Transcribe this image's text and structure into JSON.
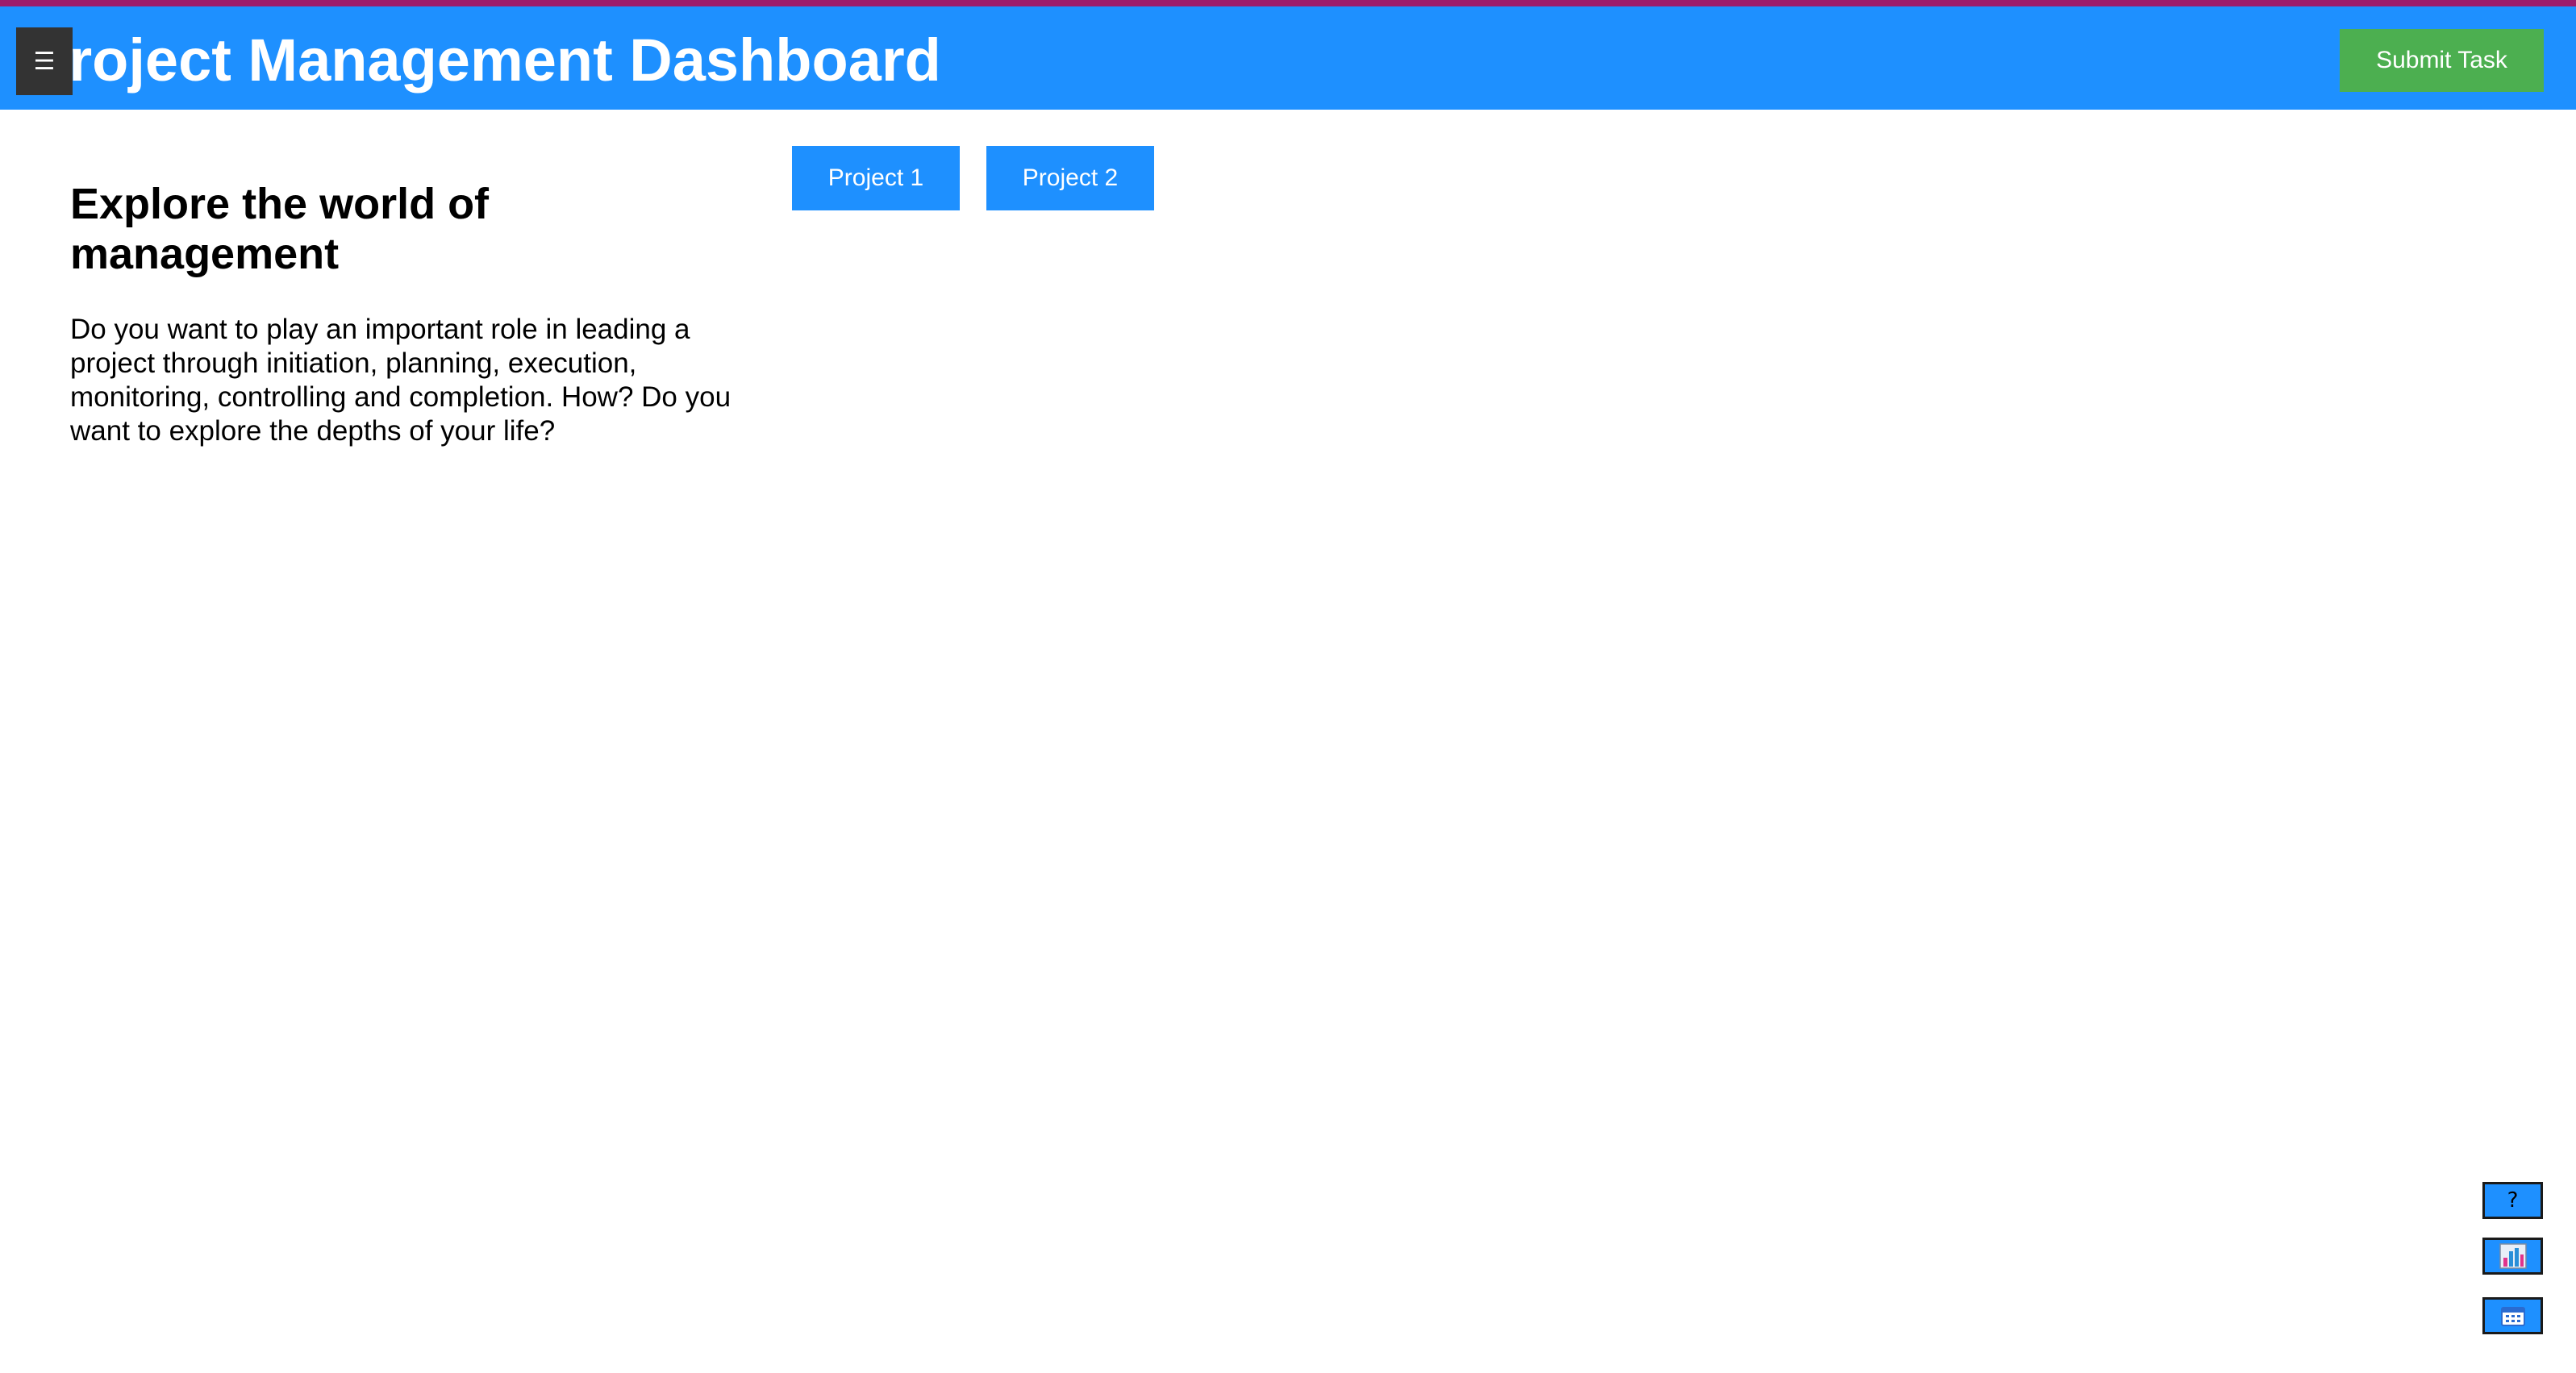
{
  "colors": {
    "accent_top": "#9c1c6b",
    "header_bg": "#1e90ff",
    "submit_bg": "#4caf50",
    "project_button_bg": "#1e90ff",
    "float_button_bg": "#1e90ff"
  },
  "header": {
    "menu_icon": "☰",
    "title": "Project Management Dashboard",
    "submit_label": "Submit Task"
  },
  "intro": {
    "heading": "Explore the world of management",
    "text": "Do you want to play an important role in leading a project through initiation, planning, execution, monitoring, controlling and completion. How? Do you want to explore the depths of your life?"
  },
  "projects": [
    {
      "label": "Project 1"
    },
    {
      "label": "Project 2"
    }
  ],
  "floating_buttons": {
    "help_label": "?",
    "chart_icon": "bar-chart-icon",
    "calendar_icon": "calendar-icon"
  }
}
